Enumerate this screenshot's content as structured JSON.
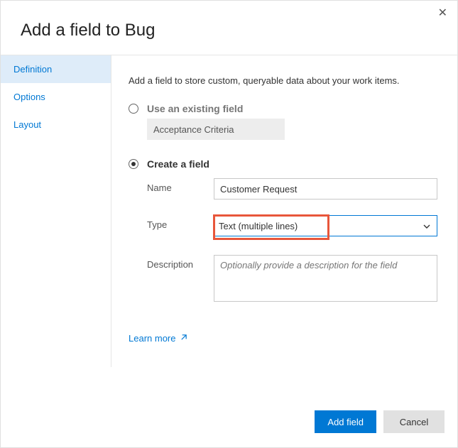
{
  "dialog": {
    "title": "Add a field to Bug",
    "intro": "Add a field to store custom, queryable data about your work items."
  },
  "sidebar": {
    "items": [
      {
        "label": "Definition",
        "active": true
      },
      {
        "label": "Options",
        "active": false
      },
      {
        "label": "Layout",
        "active": false
      }
    ]
  },
  "option_existing": {
    "label": "Use an existing field",
    "value": "Acceptance Criteria"
  },
  "option_create": {
    "label": "Create a field",
    "name_label": "Name",
    "name_value": "Customer Request",
    "type_label": "Type",
    "type_value": "Text (multiple lines)",
    "desc_label": "Description",
    "desc_placeholder": "Optionally provide a description for the field"
  },
  "learn_more": "Learn more",
  "buttons": {
    "primary": "Add field",
    "secondary": "Cancel"
  }
}
